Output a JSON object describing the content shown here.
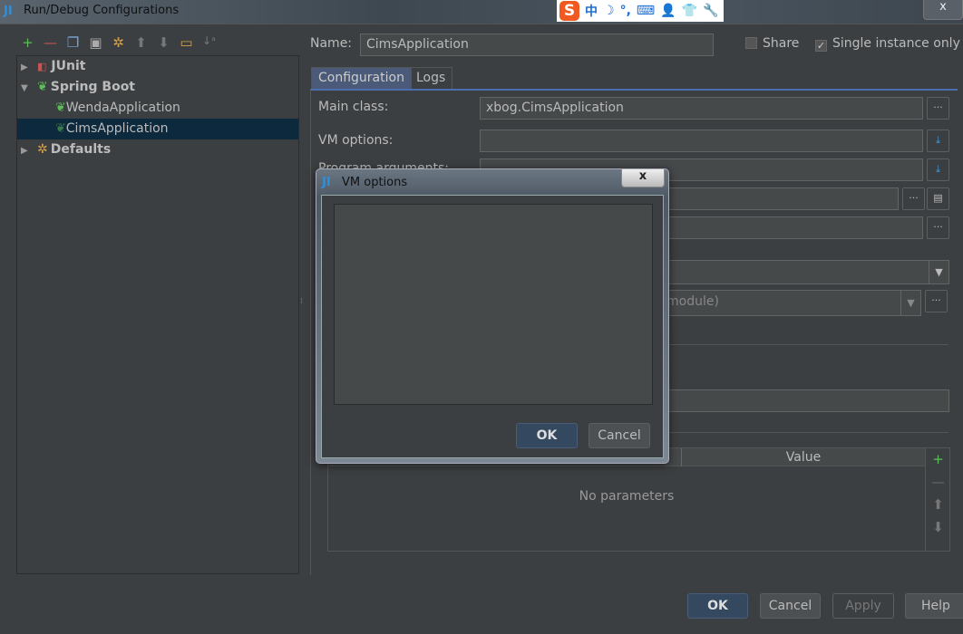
{
  "window": {
    "title": "Run/Debug Configurations",
    "close": "x"
  },
  "ime_bar": {
    "logo": "S",
    "items": [
      "中",
      "☽",
      "°,",
      "⌨",
      "👤",
      "👕",
      "🔧"
    ]
  },
  "toolbar": {
    "icons": [
      "add-icon",
      "remove-icon",
      "copy-icon",
      "save-icon",
      "edit-defaults-icon",
      "move-up-icon",
      "move-down-icon",
      "folder-icon",
      "sort-icon"
    ]
  },
  "tree": [
    {
      "label": "JUnit",
      "level": 0,
      "expanded": false,
      "bold": true
    },
    {
      "label": "Spring Boot",
      "level": 0,
      "expanded": true,
      "bold": true
    },
    {
      "label": "WendaApplication",
      "level": 1,
      "error": true
    },
    {
      "label": "CimsApplication",
      "level": 1,
      "selected": true
    },
    {
      "label": "Defaults",
      "level": 0,
      "expanded": false,
      "bold": true
    }
  ],
  "name": {
    "label": "Name:",
    "value": "CimsApplication"
  },
  "share": {
    "label": "Share",
    "checked": false
  },
  "single_instance": {
    "label": "Single instance only",
    "checked": true
  },
  "tabs": [
    "Configuration",
    "Logs"
  ],
  "form": {
    "main_class": {
      "label": "Main class:",
      "value": "xbog.CimsApplication"
    },
    "vm_options": {
      "label": "VM options:",
      "value": ""
    },
    "program_arguments": {
      "label": "Program arguments:"
    },
    "module_hint": "module)"
  },
  "params_table": {
    "column": "Value",
    "empty": "No parameters"
  },
  "vm_dialog": {
    "title": "VM options",
    "close": "x",
    "ok": "OK",
    "cancel": "Cancel",
    "value": ""
  },
  "footer": {
    "ok": "OK",
    "cancel": "Cancel",
    "apply": "Apply",
    "help": "Help"
  },
  "colors": {
    "selection": "#0d293e",
    "accent": "#4b6eaf",
    "default_button": "#344860",
    "add_green": "#5bbd57",
    "remove_red": "#c75450"
  }
}
